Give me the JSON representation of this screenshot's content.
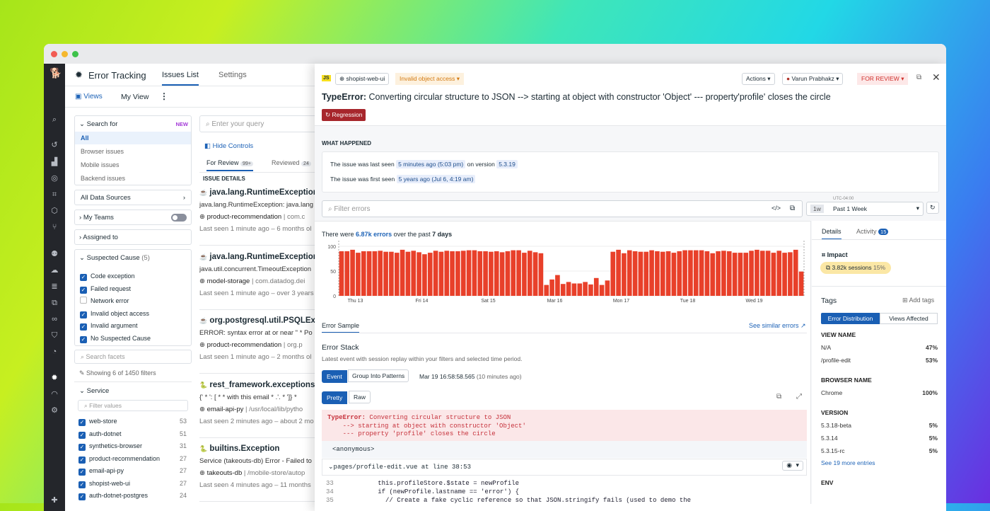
{
  "app": {
    "title": "Error Tracking",
    "tabs": [
      "Issues List",
      "Settings"
    ],
    "views_label": "Views",
    "view_name": "My View"
  },
  "filters": {
    "search_for": {
      "label": "Search for",
      "badge": "NEW",
      "options": [
        "All",
        "Browser issues",
        "Mobile issues",
        "Backend issues"
      ]
    },
    "data_sources": "All Data Sources",
    "my_teams": "My Teams",
    "assigned_to": "Assigned to",
    "suspected_cause": {
      "label": "Suspected Cause",
      "count": "(5)",
      "items": [
        {
          "label": "Code exception",
          "checked": true
        },
        {
          "label": "Failed request",
          "checked": true
        },
        {
          "label": "Network error",
          "checked": false
        },
        {
          "label": "Invalid object access",
          "checked": true
        },
        {
          "label": "Invalid argument",
          "checked": true
        },
        {
          "label": "No Suspected Cause",
          "checked": true
        }
      ]
    },
    "search_facets_placeholder": "Search facets",
    "showing": "Showing 6 of 1450 filters",
    "service": {
      "label": "Service",
      "filter_placeholder": "Filter values",
      "items": [
        {
          "label": "web-store",
          "count": "53"
        },
        {
          "label": "auth-dotnet",
          "count": "51"
        },
        {
          "label": "synthetics-browser",
          "count": "31"
        },
        {
          "label": "product-recommendation",
          "count": "27"
        },
        {
          "label": "email-api-py",
          "count": "27"
        },
        {
          "label": "shopist-web-ui",
          "count": "27"
        },
        {
          "label": "auth-dotnet-postgres",
          "count": "24"
        }
      ]
    }
  },
  "issues": {
    "query_placeholder": "Enter your query",
    "hide_controls": "Hide Controls",
    "tabs": [
      {
        "label": "For Review",
        "count": "99+"
      },
      {
        "label": "Reviewed",
        "count": "24"
      }
    ],
    "header": "ISSUE DETAILS",
    "list": [
      {
        "title": "java.lang.RuntimeException",
        "msg": "java.lang.RuntimeException: java.lang",
        "service": "product-recommendation",
        "path": "com.c",
        "seen": "Last seen 1 minute ago – 6 months ol"
      },
      {
        "title": "java.lang.RuntimeException",
        "msg": "java.util.concurrent.TimeoutException",
        "service": "model-storage",
        "path": "com.datadog.dei",
        "seen": "Last seen 1 minute ago – over 3 years"
      },
      {
        "title": "org.postgresql.util.PSQLExce",
        "msg": "ERROR: syntax error at or near \" * Po",
        "service": "product-recommendation",
        "path": "org.p",
        "seen": "Last seen 1 minute ago – 2 months ol"
      },
      {
        "title": "rest_framework.exceptions.V",
        "msg": "{' * ': [ * * with this email * .'. * ']} *",
        "service": "email-api-py",
        "path": "/usr/local/lib/pytho",
        "seen": "Last seen 2 minutes ago – about 2 mo"
      },
      {
        "title": "builtins.Exception",
        "msg": "Service (takeouts-db) Error - Failed to",
        "service": "takeouts-db",
        "path": "/mobile-store/autop",
        "seen": "Last seen 4 minutes ago – 11 months"
      }
    ]
  },
  "detail": {
    "lang": "JS",
    "service": "shopist-web-ui",
    "cause": "Invalid object access",
    "actions": "Actions",
    "assignee": "Varun Prabhakz",
    "status": "FOR REVIEW",
    "error_type": "TypeError:",
    "error_msg": "Converting circular structure to JSON --> starting at object with constructor 'Object' --- property'profile' closes the circle",
    "badge": "Regression",
    "what_happened": "WHAT HAPPENED",
    "last_seen_pre": "The issue was last seen",
    "last_seen": "5 minutes ago (5:03 pm)",
    "on_version": "on version",
    "version": "5.3.19",
    "first_seen_pre": "The issue was first seen",
    "first_seen": "5 years ago (Jul 6, 4:19 am)",
    "filter_placeholder": "Filter errors",
    "tz": "UTC-04:00",
    "range_short": "1w",
    "range": "Past 1 Week",
    "summary_pre": "There were",
    "summary_count": "6.87k errors",
    "summary_mid": "over the past",
    "summary_period": "7 days",
    "sample_tab": "Error Sample",
    "see_similar": "See similar errors",
    "stack_title": "Error Stack",
    "stack_sub": "Latest event with session replay within your filters and selected time period.",
    "event_btn": "Event",
    "group_btn": "Group Into Patterns",
    "event_time": "Mar 19 16:58:58.565",
    "event_ago": "(10 minutes ago)",
    "pretty": "Pretty",
    "raw": "Raw",
    "stack_lines": [
      "TypeError:",
      "Converting circular structure to JSON",
      "    --> starting at object with constructor 'Object'",
      "    --- property 'profile' closes the circle"
    ],
    "frame_anon": "<anonymous>",
    "frame_file": "pages/profile-edit.vue at line 38:53",
    "code": [
      {
        "n": "33",
        "t": "        this.profileStore.$state = newProfile"
      },
      {
        "n": "34",
        "t": "        if (newProfile.lastname == 'error') {"
      },
      {
        "n": "35",
        "t": "          // Create a fake cyclic reference so that JSON.stringify fails (used to demo the"
      }
    ]
  },
  "side": {
    "tabs": [
      "Details",
      "Activity"
    ],
    "activity_count": "15",
    "impact": "Impact",
    "sessions": "3.82k sessions",
    "sessions_pct": "15%",
    "tags": "Tags",
    "add_tags": "Add tags",
    "toggle": [
      "Error Distribution",
      "Views Affected"
    ],
    "groups": [
      {
        "name": "VIEW NAME",
        "rows": [
          [
            "N/A",
            "47%"
          ],
          [
            "/profile-edit",
            "53%"
          ]
        ]
      },
      {
        "name": "BROWSER NAME",
        "rows": [
          [
            "Chrome",
            "100%"
          ]
        ]
      },
      {
        "name": "VERSION",
        "rows": [
          [
            "5.3.18-beta",
            "5%"
          ],
          [
            "5.3.14",
            "5%"
          ],
          [
            "5.3.15-rc",
            "5%"
          ]
        ]
      }
    ],
    "more": "See 19 more entries",
    "env": "ENV"
  },
  "chart_data": {
    "type": "bar",
    "title": "",
    "xlabel": "",
    "ylabel": "",
    "ylim": [
      0,
      100
    ],
    "yticks": [
      "0",
      "50",
      "100"
    ],
    "xticks": [
      "Thu 13",
      "Fri 14",
      "Sat 15",
      "Mar 16",
      "Mon 17",
      "Tue 18",
      "Wed 19"
    ],
    "bar_color": "#e8402a",
    "values": [
      90,
      90,
      93,
      87,
      90,
      90,
      90,
      91,
      89,
      89,
      87,
      93,
      89,
      91,
      88,
      84,
      87,
      91,
      89,
      91,
      90,
      90,
      91,
      92,
      92,
      90,
      90,
      89,
      90,
      88,
      90,
      92,
      92,
      87,
      91,
      88,
      86,
      22,
      33,
      42,
      24,
      28,
      25,
      25,
      28,
      23,
      36,
      22,
      31,
      89,
      93,
      86,
      92,
      90,
      89,
      89,
      92,
      90,
      89,
      90,
      87,
      90,
      92,
      92,
      92,
      92,
      90,
      86,
      90,
      91,
      90,
      87,
      87,
      87,
      91,
      93,
      91,
      91,
      87,
      91,
      87,
      88,
      93,
      49
    ]
  }
}
